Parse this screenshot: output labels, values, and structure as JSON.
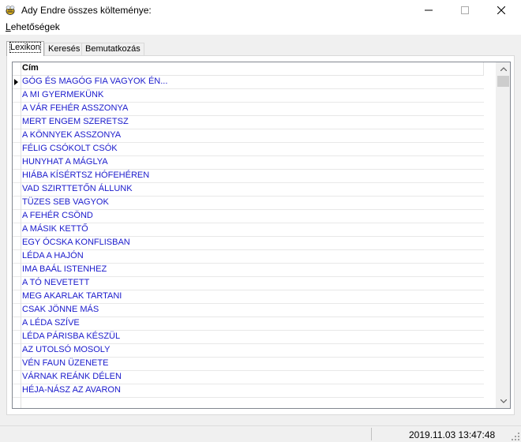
{
  "window": {
    "title": "Ady Endre összes költeménye:"
  },
  "menu": {
    "item_first": "L",
    "item_rest": "ehetőségek"
  },
  "tabs": [
    {
      "label": "Lexikon",
      "active": true
    },
    {
      "label": "Keresés",
      "active": false
    },
    {
      "label": "Bemutatkozás",
      "active": false
    }
  ],
  "grid": {
    "column_header": "Cím",
    "selected_index": 0,
    "rows": [
      "GÓG ÉS MAGÓG FIA VAGYOK ÉN...",
      "A MI GYERMEKÜNK",
      "A VÁR FEHÉR ASSZONYA",
      "MERT ENGEM SZERETSZ",
      "A KÖNNYEK ASSZONYA",
      "FÉLIG CSÓKOLT CSÓK",
      "HUNYHAT A MÁGLYA",
      "HIÁBA KÍSÉRTSZ HÓFEHÉREN",
      "VAD SZIRTTETŐN ÁLLUNK",
      "TÜZES SEB VAGYOK",
      "A FEHÉR CSÖND",
      "A MÁSIK KETTŐ",
      "EGY ÓCSKA KONFLISBAN",
      "LÉDA A HAJÓN",
      "IMA BAÁL ISTENHEZ",
      "A TÓ NEVETETT",
      "MEG AKARLAK TARTANI",
      "CSAK JÖNNE MÁS",
      "A LÉDA SZÍVE",
      "LÉDA PÁRISBA KÉSZÜL",
      "AZ UTOLSÓ MOSOLY",
      "VÉN FAUN ÜZENETE",
      "VÁRNAK REÁNK DÉLEN",
      "HÉJA-NÁSZ AZ AVARON"
    ]
  },
  "status": {
    "datetime": "2019.11.03 13:47:48"
  },
  "icons": {
    "app": "bee-icon",
    "minimize": "minimize-icon",
    "maximize": "maximize-icon",
    "close": "close-icon",
    "scroll_up": "chevron-up-icon",
    "scroll_down": "chevron-down-icon",
    "row_pointer": "row-selector-arrow-icon",
    "grip": "resize-grip-icon"
  },
  "colors": {
    "link_text": "#1a1acc"
  }
}
